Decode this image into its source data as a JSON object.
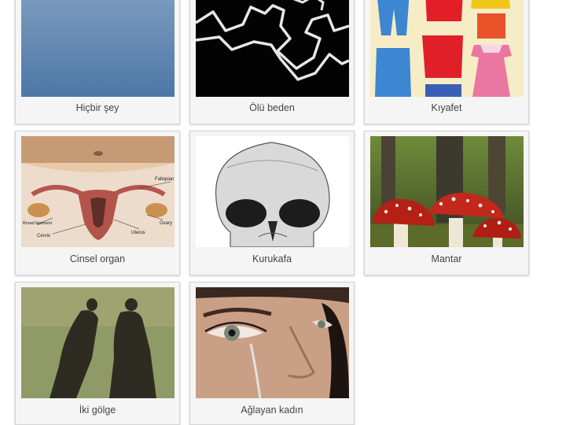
{
  "grid": {
    "items": [
      {
        "label": "Hiçbir şey",
        "image": "empty-sky-image"
      },
      {
        "label": "Ölü beden",
        "image": "chalk-outline-image"
      },
      {
        "label": "Kıyafet",
        "image": "clothing-image"
      },
      {
        "label": "Cinsel organ",
        "image": "anatomy-image"
      },
      {
        "label": "Kurukafa",
        "image": "skull-image"
      },
      {
        "label": "Mantar",
        "image": "mushroom-image"
      },
      {
        "label": "İki gölge",
        "image": "two-shadows-image"
      },
      {
        "label": "Ağlayan kadın",
        "image": "crying-woman-image"
      }
    ]
  },
  "anatomy_labels": {
    "fallopian": "Fallopian",
    "ovary": "Ovary",
    "uterus": "Uterus",
    "broad_ligament": "Broad ligament",
    "cervix": "Cervix"
  },
  "colors": {
    "card_background": "#f5f5f5",
    "card_border": "#d4d4d4",
    "caption_text": "#444444"
  }
}
